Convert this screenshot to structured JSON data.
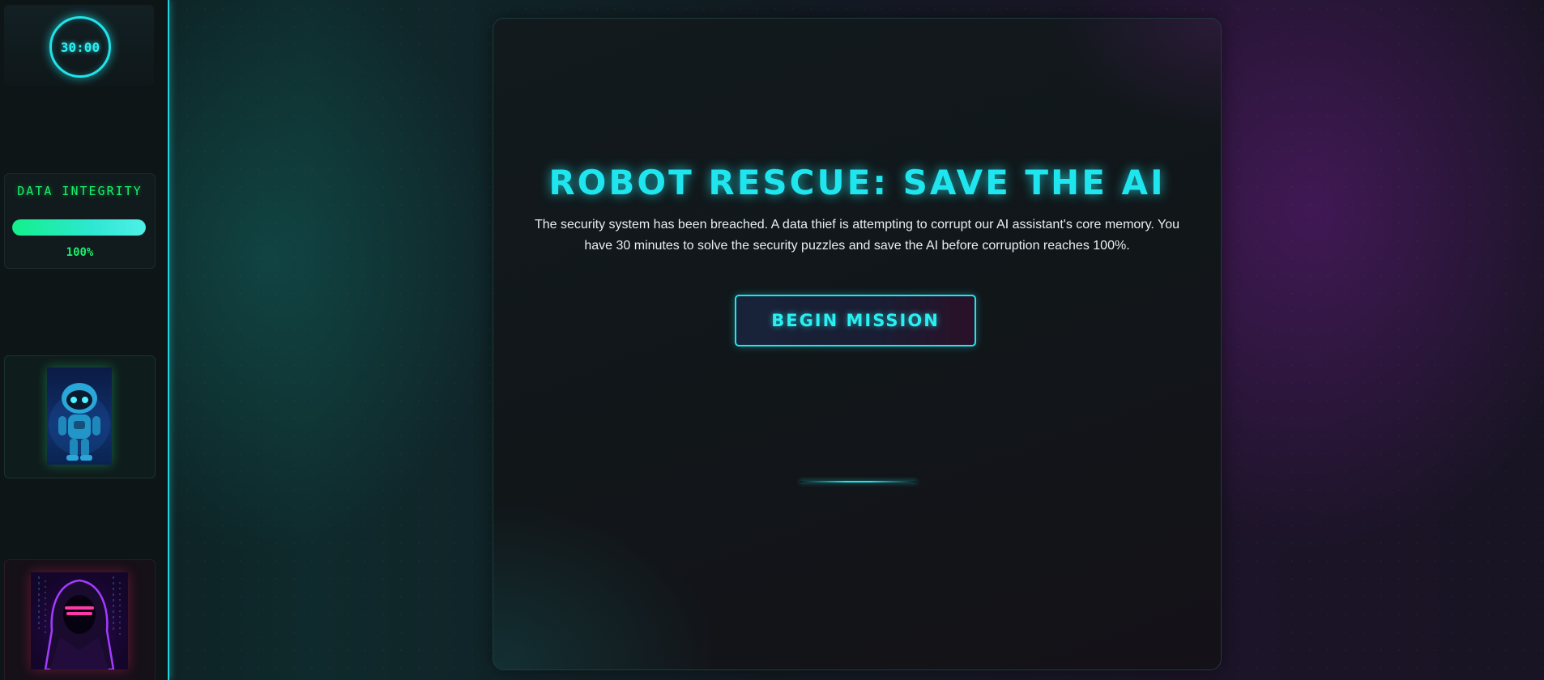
{
  "sidebar": {
    "timer": {
      "value": "30:00"
    },
    "integrity": {
      "title": "DATA INTEGRITY",
      "percent_label": "100%",
      "percent": 100
    },
    "robot": {
      "icon": "robot-icon"
    },
    "hacker": {
      "icon": "hooded-hacker-icon"
    }
  },
  "main": {
    "title": "ROBOT RESCUE: SAVE THE AI",
    "description": "The security system has been breached. A data thief is attempting to corrupt our AI assistant's core memory. You have 30 minutes to solve the security puzzles and save the AI before corruption reaches 100%.",
    "begin_button": "BEGIN MISSION"
  },
  "colors": {
    "accent_cyan": "#1fe6ee",
    "accent_green": "#19f06a",
    "accent_magenta": "#ff2a9a"
  }
}
